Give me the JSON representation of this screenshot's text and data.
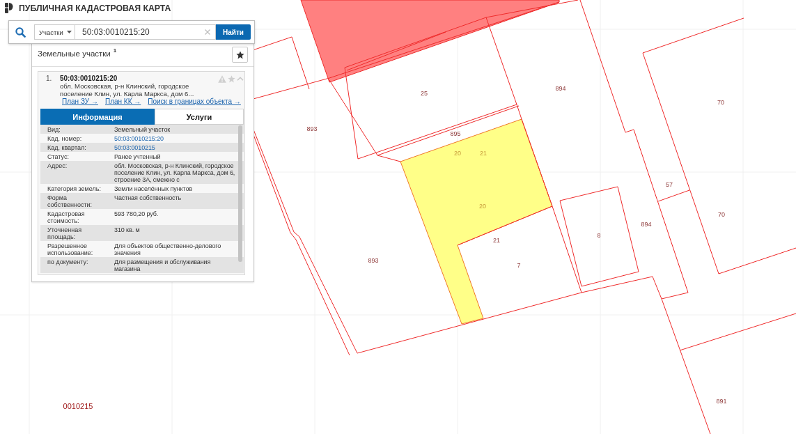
{
  "header": {
    "title": "ПУБЛИЧНАЯ КАДАСТРОВАЯ КАРТА"
  },
  "search": {
    "category": "Участки",
    "value": "50:03:0010215:20",
    "button": "Найти"
  },
  "results": {
    "heading": "Земельные участки",
    "count": "1",
    "items": [
      {
        "index": "1.",
        "number": "50:03:0010215:20",
        "address": "обл. Московская, р-н Клинский, городское поселение Клин, ул. Карла Маркса, дом 6...",
        "expanded": true,
        "links": [
          "План ЗУ →",
          "План КК →",
          "Поиск в границах объекта →"
        ],
        "tabs": [
          {
            "label": "Информация",
            "selected": true
          },
          {
            "label": "Услуги",
            "selected": false
          }
        ],
        "fields": [
          {
            "label": "Вид:",
            "value": "Земельный участок",
            "kind": "text"
          },
          {
            "label": "Кад. номер:",
            "value": "50:03:0010215:20",
            "kind": "link"
          },
          {
            "label": "Кад. квартал:",
            "value": "50:03:0010215",
            "kind": "link"
          },
          {
            "label": "Статус:",
            "value": "Ранее учтенный",
            "kind": "text"
          },
          {
            "label": "Адрес:",
            "value": "обл. Московская, р-н Клинский, городское поселение Клин, ул. Карла Маркса, дом 6, строение 3А, смежно с",
            "kind": "text"
          },
          {
            "label": "Категория земель:",
            "value": "Земли населённых пунктов",
            "kind": "text"
          },
          {
            "label": "Форма собственности:",
            "value": "Частная собственность",
            "kind": "text"
          },
          {
            "label": "Кадастровая стоимость:",
            "value": "593 780,20 руб.",
            "kind": "text"
          },
          {
            "label": "Уточненная площадь:",
            "value": "310 кв. м",
            "kind": "text"
          },
          {
            "label": "Разрешенное использование:",
            "value": "Для объектов общественно-делового значения",
            "kind": "text"
          },
          {
            "label": "по документу:",
            "value": "Для размещения и обслуживания магазина",
            "kind": "text"
          }
        ]
      }
    ]
  },
  "map": {
    "quarter": "0010215",
    "labels": [
      {
        "text": "25",
        "selected": false
      },
      {
        "text": "894",
        "selected": false
      },
      {
        "text": "70",
        "selected": false
      },
      {
        "text": "893",
        "selected": false
      },
      {
        "text": "895",
        "selected": false
      },
      {
        "text": "20",
        "selected": true
      },
      {
        "text": "21",
        "selected": true
      },
      {
        "text": "57",
        "selected": false
      },
      {
        "text": "20",
        "selected": true
      },
      {
        "text": "70",
        "selected": false
      },
      {
        "text": "894",
        "selected": false
      },
      {
        "text": "8",
        "selected": false
      },
      {
        "text": "21",
        "selected": false
      },
      {
        "text": "893",
        "selected": false
      },
      {
        "text": "7",
        "selected": false
      },
      {
        "text": "891",
        "selected": false
      }
    ]
  }
}
